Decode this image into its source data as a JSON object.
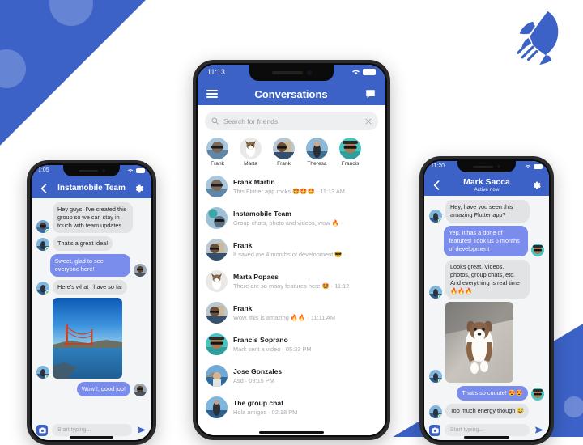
{
  "meta": {
    "brand_blue": "#3c62c8",
    "bubble_sent": "#7a8cec",
    "bubble_received": "#e2e3e5",
    "background": "#ffffff"
  },
  "decor": {
    "rocket_icon": "rocket-icon",
    "corner_top_left": "blue-triangle-with-dots",
    "corner_bottom_right": "blue-triangle-with-dots"
  },
  "left_phone": {
    "status": {
      "time": "1:05",
      "wifi_icon": "wifi-icon",
      "battery_icon": "battery-icon"
    },
    "nav": {
      "back_icon": "chevron-left-icon",
      "title": "Instamobile Team",
      "settings_icon": "gear-icon"
    },
    "messages": [
      {
        "side": "them",
        "type": "text",
        "text": "Hey guys, I've created this group so we can stay in touch with team updates",
        "avatar": "avatar-sunglasses"
      },
      {
        "side": "them",
        "type": "text",
        "text": "That's a great idea!",
        "avatar": "avatar-beach"
      },
      {
        "side": "me",
        "type": "text",
        "text": "Sweet, glad to see everyone here!",
        "avatar": "avatar-me"
      },
      {
        "side": "them",
        "type": "text",
        "text": "Here's what I have so far",
        "avatar": "avatar-beach"
      },
      {
        "side": "them",
        "type": "photo",
        "text": "golden-gate-bridge-photo",
        "avatar": "avatar-beach"
      },
      {
        "side": "me",
        "type": "text",
        "text": "Wow !, good job!",
        "avatar": "avatar-me"
      }
    ],
    "composer": {
      "camera_icon": "camera-icon",
      "placeholder": "Start typing...",
      "send_icon": "send-icon"
    }
  },
  "center_phone": {
    "status": {
      "time": "11:13",
      "wifi_icon": "wifi-icon",
      "battery_icon": "battery-icon"
    },
    "nav": {
      "menu_icon": "hamburger-menu-icon",
      "title": "Conversations",
      "compose_icon": "new-message-icon"
    },
    "search": {
      "icon": "search-icon",
      "placeholder": "Search for friends",
      "value": "",
      "clear_icon": "close-icon"
    },
    "stories": [
      {
        "name": "Frank",
        "avatar": "avatar-frank-1"
      },
      {
        "name": "Marta",
        "avatar": "avatar-marta-dog"
      },
      {
        "name": "Frank",
        "avatar": "avatar-frank-2"
      },
      {
        "name": "Theresa",
        "avatar": "avatar-theresa"
      },
      {
        "name": "Francis",
        "avatar": "avatar-francis"
      }
    ],
    "conversations": [
      {
        "name": "Frank Martin",
        "preview": "This Flutter app rocks 🤩🤩🤩 · 11:13 AM",
        "avatar": "avatar-frank-1"
      },
      {
        "name": "Instamobile Team",
        "preview": "Group chats, photo and videos, wow 🔥 ·",
        "avatar": "avatar-group"
      },
      {
        "name": "Frank",
        "preview": "It saved me 4 months of development 😎 ·",
        "avatar": "avatar-frank-2"
      },
      {
        "name": "Marta Popaes",
        "preview": "There are so many features here 🤩 · 11:12",
        "avatar": "avatar-marta-dog"
      },
      {
        "name": "Frank",
        "preview": "Wow, this is amazing 🔥🔥 · 11:11 AM",
        "avatar": "avatar-frank-2"
      },
      {
        "name": "Francis Soprano",
        "preview": "Mark sent a video · 05:33 PM",
        "avatar": "avatar-francis"
      },
      {
        "name": "Jose Gonzales",
        "preview": "Asd · 09:15 PM",
        "avatar": "avatar-jose"
      },
      {
        "name": "The group chat",
        "preview": "Hola amigos · 02:18 PM",
        "avatar": "avatar-beach"
      }
    ]
  },
  "right_phone": {
    "status": {
      "time": "11:20",
      "wifi_icon": "wifi-icon",
      "battery_icon": "battery-icon"
    },
    "nav": {
      "back_icon": "chevron-left-icon",
      "title": "Mark Sacca",
      "subtitle": "Active now",
      "settings_icon": "gear-icon"
    },
    "messages": [
      {
        "side": "them",
        "type": "text",
        "text": "Hey, have you seen this amazing Flutter app?",
        "avatar": "avatar-beach"
      },
      {
        "side": "me",
        "type": "text",
        "text": "Yep, it has a done of features! Took us 6 months of development",
        "avatar": "avatar-me"
      },
      {
        "side": "them",
        "type": "text",
        "text": "Looks great. Videos, photos, group chats, etc. And everything is real time 🔥🔥🔥",
        "avatar": "avatar-beach"
      },
      {
        "side": "them",
        "type": "photo",
        "text": "running-dog-photo",
        "avatar": "avatar-beach"
      },
      {
        "side": "me",
        "type": "text",
        "text": "That's so cuuute! 😍😍",
        "avatar": "avatar-me"
      },
      {
        "side": "them",
        "type": "text",
        "text": "Too much energy though 😅",
        "avatar": "avatar-beach"
      }
    ],
    "composer": {
      "camera_icon": "camera-icon",
      "placeholder": "Start typing...",
      "send_icon": "send-icon"
    }
  }
}
